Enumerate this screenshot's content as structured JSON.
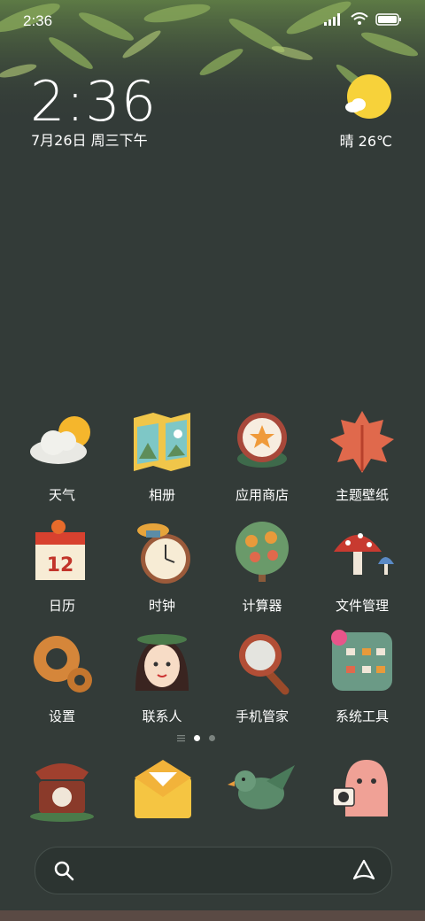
{
  "status_bar": {
    "time": "2:36"
  },
  "clock": {
    "time": "2:36",
    "date": "7月26日 周三下午"
  },
  "weather": {
    "text": "晴 26℃",
    "icon": "sun-cloud-icon"
  },
  "apps": [
    {
      "label": "天气",
      "icon": "weather-app-icon"
    },
    {
      "label": "相册",
      "icon": "gallery-app-icon"
    },
    {
      "label": "应用商店",
      "icon": "app-store-icon"
    },
    {
      "label": "主题壁纸",
      "icon": "themes-app-icon"
    },
    {
      "label": "日历",
      "icon": "calendar-app-icon"
    },
    {
      "label": "时钟",
      "icon": "clock-app-icon"
    },
    {
      "label": "计算器",
      "icon": "calculator-app-icon"
    },
    {
      "label": "文件管理",
      "icon": "file-manager-icon"
    },
    {
      "label": "设置",
      "icon": "settings-app-icon"
    },
    {
      "label": "联系人",
      "icon": "contacts-app-icon"
    },
    {
      "label": "手机管家",
      "icon": "security-app-icon"
    },
    {
      "label": "系统工具",
      "icon": "system-tools-icon"
    }
  ],
  "calendar_day": "12",
  "dock": [
    {
      "icon": "phone-app-icon"
    },
    {
      "icon": "messages-app-icon"
    },
    {
      "icon": "browser-app-icon"
    },
    {
      "icon": "camera-app-icon"
    }
  ],
  "page_indicator": {
    "pages": 2,
    "active": 1
  },
  "search": {
    "icon": "search-icon",
    "assistant_icon": "assistant-icon"
  }
}
